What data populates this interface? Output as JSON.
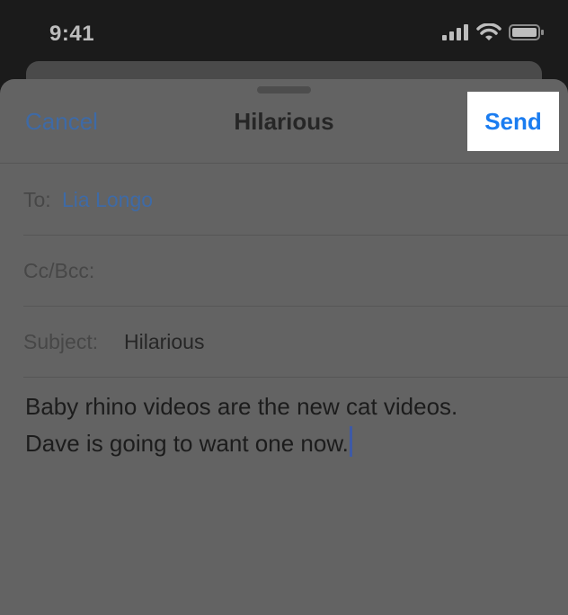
{
  "status_bar": {
    "time": "9:41",
    "icons": [
      "cellular-signal-icon",
      "wifi-icon",
      "battery-icon"
    ]
  },
  "compose": {
    "cancel_label": "Cancel",
    "title": "Hilarious",
    "send_label": "Send",
    "to_label": "To:",
    "to_value": "Lia Longo",
    "ccbcc_label": "Cc/Bcc:",
    "subject_label": "Subject:",
    "subject_value": "Hilarious",
    "body_line1": "Baby rhino videos are the new cat videos.",
    "body_line2": "Dave is going to want one now."
  },
  "colors": {
    "link_blue": "#3e6aa6",
    "send_blue": "#1a7cf0",
    "sheet_bg": "#636363",
    "highlight": "#ffffff"
  }
}
